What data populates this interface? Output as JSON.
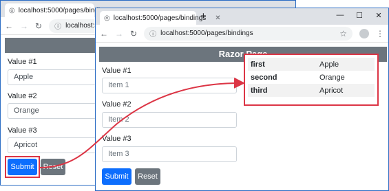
{
  "back_window": {
    "tab": {
      "title": "localhost:5000/pages/bindings",
      "icon": "globe-icon"
    },
    "address": {
      "url": "localhost:5000/"
    },
    "labels": [
      "Value #1",
      "Value #2",
      "Value #3"
    ],
    "values": [
      "Apple",
      "Orange",
      "Apricot"
    ],
    "submit_label": "Submit",
    "reset_label": "Reset"
  },
  "front_window": {
    "tab": {
      "title": "localhost:5000/pages/bindings",
      "icon": "globe-icon"
    },
    "new_tab_label": "+",
    "window_controls": {
      "minimize": "—",
      "maximize": "☐",
      "close": "✕"
    },
    "address": {
      "url": "localhost:5000/pages/bindings"
    },
    "header": "Razor Page",
    "labels": [
      "Value #1",
      "Value #2",
      "Value #3"
    ],
    "placeholders": [
      "Item 1",
      "Item 2",
      "Item 3"
    ],
    "submit_label": "Submit",
    "reset_label": "Reset",
    "results": [
      {
        "key": "first",
        "value": "Apple"
      },
      {
        "key": "second",
        "value": "Orange"
      },
      {
        "key": "third",
        "value": "Apricot"
      }
    ]
  },
  "annotation_color": "#dc3545",
  "accent_color": "#0d6efd"
}
